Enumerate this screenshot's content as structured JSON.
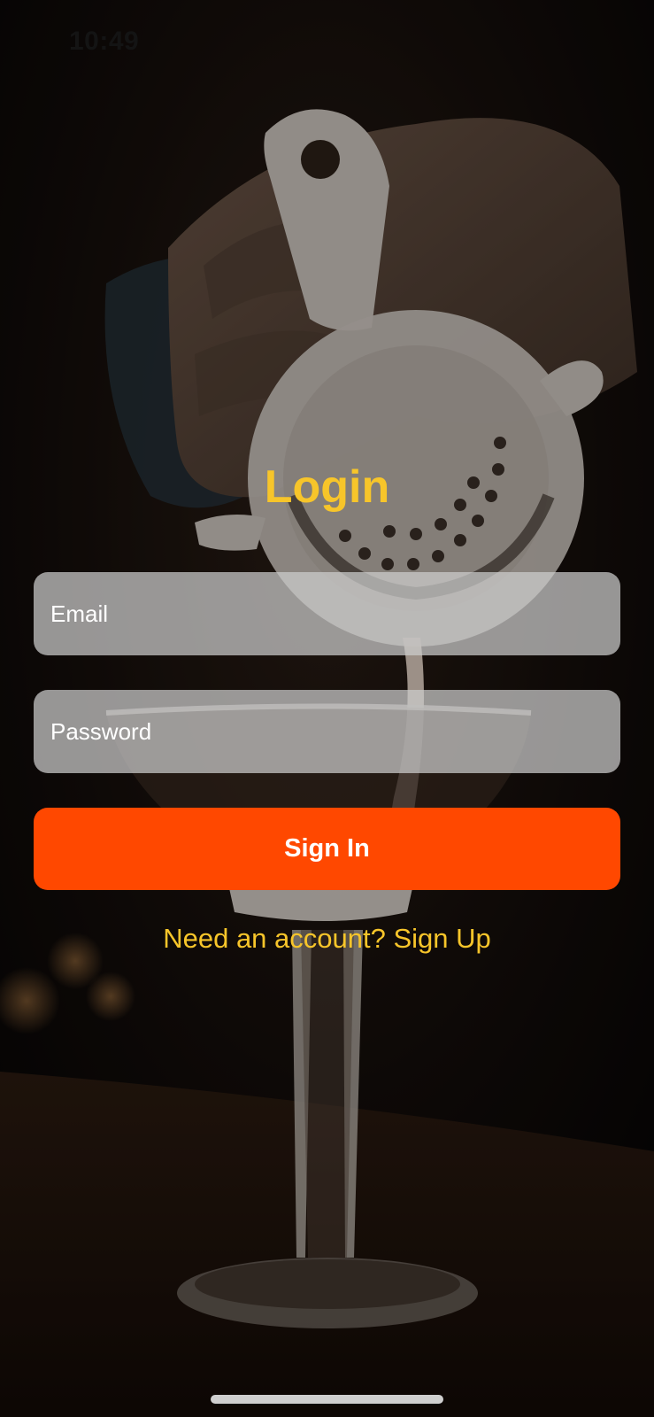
{
  "status_bar": {
    "time": "10:49"
  },
  "login": {
    "title": "Login",
    "email_placeholder": "Email",
    "email_value": "",
    "password_placeholder": "Password",
    "password_value": "",
    "sign_in_label": "Sign In",
    "signup_link": "Need an account? Sign Up"
  },
  "colors": {
    "accent_yellow": "#f7c52a",
    "button_orange": "#ff4800",
    "field_fill": "rgba(205,205,205,0.72)",
    "background": "#0b0807"
  },
  "background_image": {
    "subject": "bartender-pouring-cocktail-through-strainer-into-coupe-glass"
  }
}
